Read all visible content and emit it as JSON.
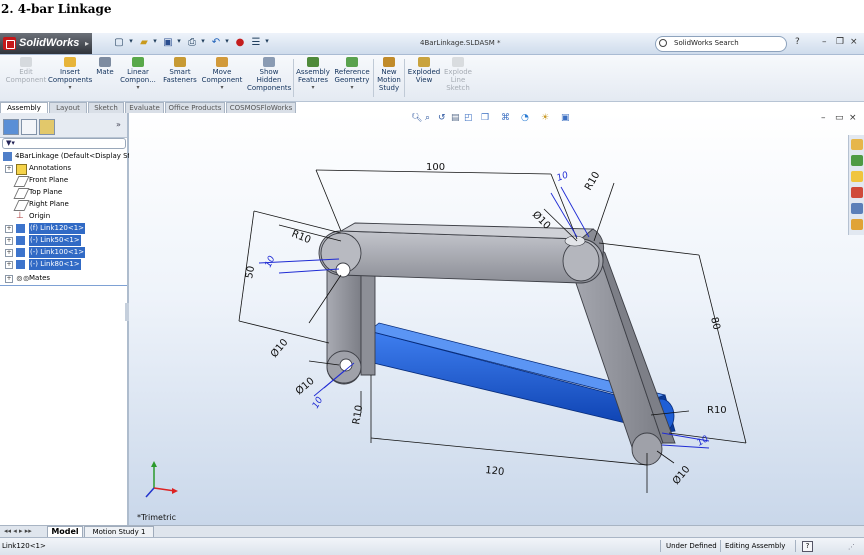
{
  "heading": "2. 4-bar Linkage",
  "titlebar": {
    "app_name": "SolidWorks",
    "document_title": "4BarLinkage.SLDASM *",
    "search_placeholder": "SolidWorks Search",
    "help": "?",
    "minimize": "–",
    "restore": "❐",
    "close": "×"
  },
  "commands": [
    {
      "label": "Edit Component",
      "enabled": false
    },
    {
      "label": "Insert Components",
      "enabled": true
    },
    {
      "label": "Mate",
      "enabled": true
    },
    {
      "label": "Linear Compon...",
      "enabled": true
    },
    {
      "label": "Smart Fasteners",
      "enabled": true
    },
    {
      "label": "Move Component",
      "enabled": true
    },
    {
      "label": "Show Hidden Components",
      "enabled": true
    },
    {
      "label": "Assembly Features",
      "enabled": true
    },
    {
      "label": "Reference Geometry",
      "enabled": true
    },
    {
      "label": "New Motion Study",
      "enabled": true
    },
    {
      "label": "Exploded View",
      "enabled": true
    },
    {
      "label": "Explode Line Sketch",
      "enabled": false
    }
  ],
  "tabs": [
    "Assembly",
    "Layout",
    "Sketch",
    "Evaluate",
    "Office Products",
    "COSMOSFloWorks"
  ],
  "feature_tree": {
    "filter_icon": "funnel-icon",
    "root": "4BarLinkage  (Default<Display Sta",
    "items": [
      {
        "label": "Annotations",
        "selected": false,
        "expand": "+"
      },
      {
        "label": "Front Plane",
        "selected": false,
        "expand": ""
      },
      {
        "label": "Top Plane",
        "selected": false,
        "expand": ""
      },
      {
        "label": "Right Plane",
        "selected": false,
        "expand": ""
      },
      {
        "label": "Origin",
        "selected": false,
        "expand": ""
      },
      {
        "label": "(f) Link120<1>",
        "selected": true,
        "expand": "+"
      },
      {
        "label": "(-) Link50<1>",
        "selected": true,
        "expand": "+"
      },
      {
        "label": "(-) Link100<1>",
        "selected": true,
        "expand": "+"
      },
      {
        "label": "(-) Link80<1>",
        "selected": true,
        "expand": "+"
      },
      {
        "label": "Mates",
        "selected": false,
        "expand": "+"
      }
    ]
  },
  "dimensions": {
    "d100": "100",
    "d50": "50",
    "d80": "80",
    "d120": "120",
    "r10_a": "R10",
    "r10_b": "R10",
    "r10_c": "R10",
    "r10_d": "R10",
    "dia10_a": "Ø10",
    "dia10_b": "Ø10",
    "dia10_c": "Ø10",
    "dia10_d": "Ø10",
    "t10_a": "10",
    "t10_b": "10",
    "t10_c": "10",
    "t10_d": "10"
  },
  "view_label": "*Trimetric",
  "bottom_tabs": [
    "Model",
    "Motion Study 1"
  ],
  "status": {
    "selection": "Link120<1>",
    "defined": "Under Defined",
    "mode": "Editing Assembly",
    "help": "?"
  },
  "colors": {
    "link_gray": "#a3a5ad",
    "link_blue": "#1f5fd6",
    "selection": "#316ac5"
  }
}
